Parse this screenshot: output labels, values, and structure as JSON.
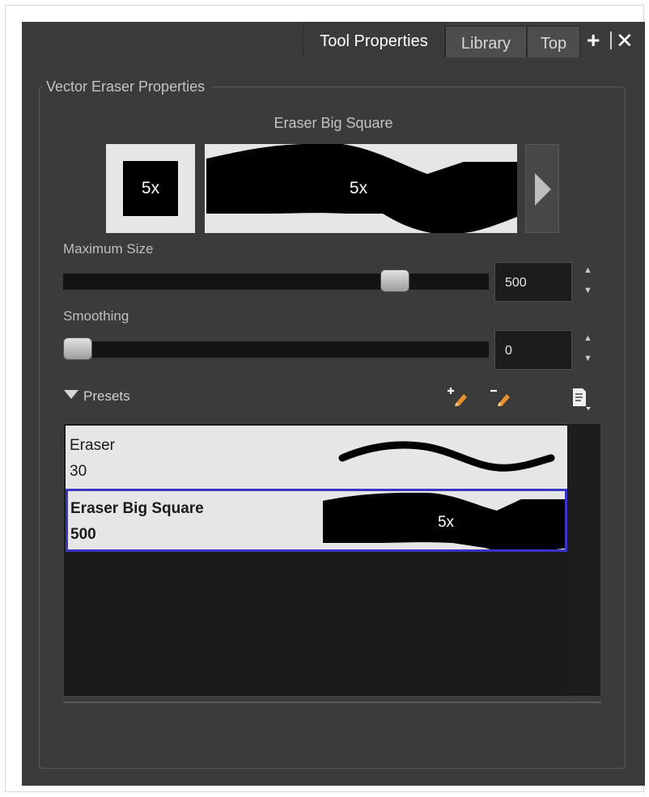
{
  "tabs": [
    {
      "label": "Tool Properties",
      "active": true
    },
    {
      "label": "Library",
      "active": false
    },
    {
      "label": "Top",
      "active": false
    }
  ],
  "header_icons": {
    "add": "plus-icon",
    "close": "close-icon"
  },
  "group_title": "Vector Eraser Properties",
  "brush": {
    "name": "Eraser Big Square",
    "tip_label": "5x",
    "stroke_label": "5x"
  },
  "maximum_size": {
    "label": "Maximum Size",
    "value": "500",
    "slider_fraction": 0.8
  },
  "smoothing": {
    "label": "Smoothing",
    "value": "0",
    "slider_fraction": 0.0
  },
  "presets": {
    "label": "Presets",
    "expanded": true,
    "toolbar_icons": [
      "new-preset-icon",
      "delete-preset-icon",
      "preset-menu-icon"
    ],
    "items": [
      {
        "name": "Eraser",
        "size": "30",
        "selected": false,
        "preview": "thin-curve-stroke"
      },
      {
        "name": "Eraser Big Square",
        "size": "500",
        "selected": true,
        "preview": "thick-wavy-stroke",
        "preview_label": "5x"
      }
    ]
  },
  "colors": {
    "panel_bg": "#3b3b3b",
    "preview_bg": "#e6e6e6",
    "selection_border": "#3a36c4",
    "pencil_orange": "#e8902a"
  }
}
